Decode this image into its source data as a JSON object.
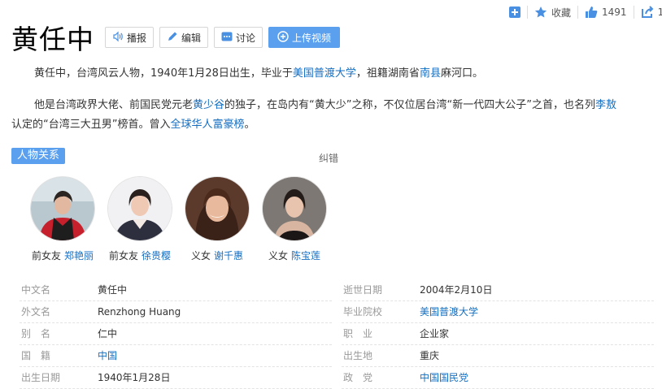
{
  "toolbar": {
    "collect_label": "收藏",
    "like_count": "1491",
    "share_count": "1"
  },
  "title": "黄任中",
  "actions": {
    "listen": "播报",
    "edit": "编辑",
    "discuss": "讨论",
    "upload": "上传视频"
  },
  "intro": {
    "p1_a": "黄任中，台湾风云人物，1940年1月28日出生，毕业于",
    "p1_link1": "美国普渡大学",
    "p1_b": "，祖籍湖南省",
    "p1_link2": "南县",
    "p1_c": "麻河口。",
    "p2_a": "他是台湾政界大佬、前国民党元老",
    "p2_link1": "黄少谷",
    "p2_b": "的独子，在岛内有“黄大少”之称，不仅位居台湾“新一代四大公子”之首，也名列",
    "p2_link2": "李敖",
    "p2_c": "认定的“台湾三大丑男”榜首。曾入",
    "p2_link3": "全球华人富豪榜",
    "p2_d": "。"
  },
  "relations": {
    "tag": "人物关系",
    "correct": "纠错",
    "people": [
      {
        "relation": "前女友",
        "name": "郑艳丽"
      },
      {
        "relation": "前女友",
        "name": "徐贵樱"
      },
      {
        "relation": "义女",
        "name": "谢千惠"
      },
      {
        "relation": "义女",
        "name": "陈宝莲"
      }
    ]
  },
  "info_left": [
    {
      "key": "中文名",
      "value": "黄任中"
    },
    {
      "key": "外文名",
      "value": "Renzhong Huang"
    },
    {
      "key": "别　名",
      "value": "仁中"
    },
    {
      "key": "国　籍",
      "value": "中国"
    },
    {
      "key": "出生日期",
      "value": "1940年1月28日"
    }
  ],
  "info_right": [
    {
      "key": "逝世日期",
      "value": "2004年2月10日"
    },
    {
      "key": "毕业院校",
      "value": "美国普渡大学"
    },
    {
      "key": "职　业",
      "value": "企业家"
    },
    {
      "key": "出生地",
      "value": "重庆"
    },
    {
      "key": "政　党",
      "value": "中国国民党"
    }
  ],
  "colors": {
    "link": "#136ec2",
    "accent": "#5aa0ef"
  }
}
